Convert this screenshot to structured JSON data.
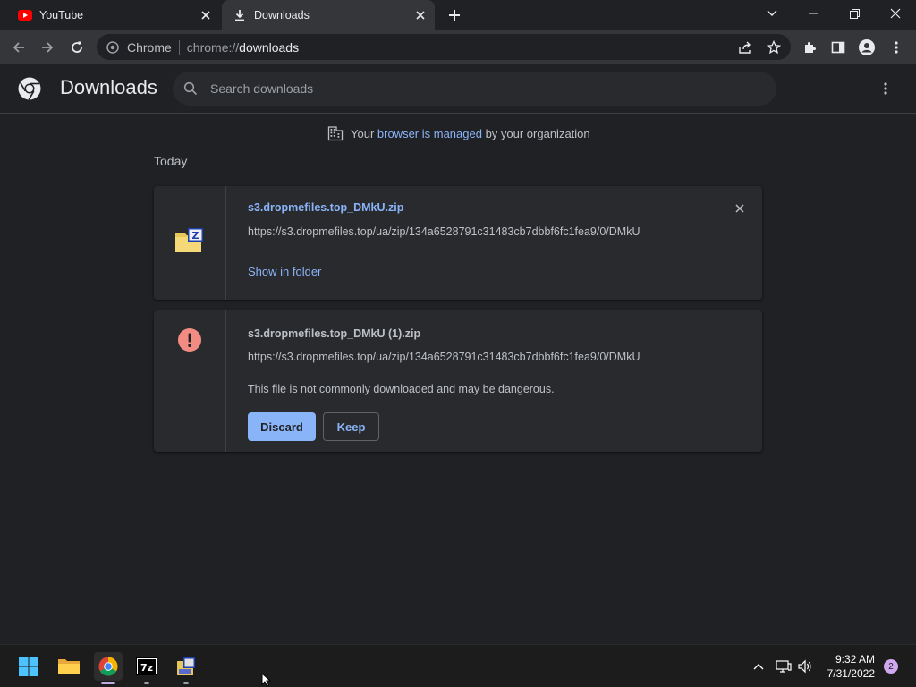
{
  "tabs": [
    {
      "label": "YouTube",
      "icon": "youtube-icon",
      "active": false
    },
    {
      "label": "Downloads",
      "icon": "download-icon",
      "active": true
    }
  ],
  "omnibox": {
    "chip": "Chrome",
    "url_scheme": "chrome://",
    "url_host": "downloads"
  },
  "header": {
    "title": "Downloads",
    "search_placeholder": "Search downloads"
  },
  "managed": {
    "prefix": "Your ",
    "link": "browser is managed",
    "suffix": " by your organization"
  },
  "section_label": "Today",
  "downloads": [
    {
      "filename": "s3.dropmefiles.top_DMkU.zip",
      "url": "https://s3.dropmefiles.top/ua/zip/134a6528791c31483cb7dbbf6fc1fea9/0/DMkU",
      "action": "Show in folder",
      "icon": "zip-file-icon"
    },
    {
      "filename": "s3.dropmefiles.top_DMkU (1).zip",
      "url": "https://s3.dropmefiles.top/ua/zip/134a6528791c31483cb7dbbf6fc1fea9/0/DMkU",
      "warning": "This file is not commonly downloaded and may be dangerous.",
      "discard_label": "Discard",
      "keep_label": "Keep",
      "icon": "warning-icon"
    }
  ],
  "taskbar": {
    "time": "9:32 AM",
    "date": "7/31/2022",
    "notification_count": "2",
    "apps": [
      "windows-start-icon",
      "file-explorer-icon",
      "chrome-icon",
      "7zip-icon",
      "archive-app-icon"
    ]
  },
  "colors": {
    "accent": "#8ab4f8",
    "background": "#202124",
    "card": "#292a2d",
    "warning": "#f28b82"
  }
}
